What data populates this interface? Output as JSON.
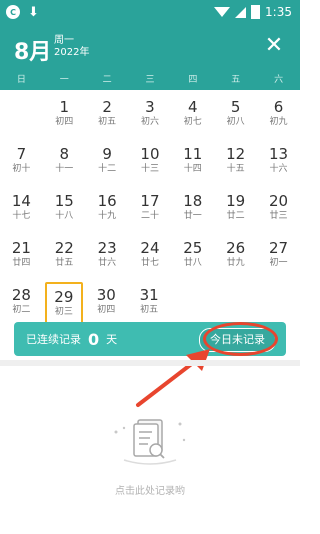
{
  "status_bar": {
    "time": "1:35"
  },
  "header": {
    "month": "8月",
    "weekday": "周一",
    "year": "2022年",
    "close_symbol": "✕"
  },
  "weekdays": [
    "日",
    "一",
    "二",
    "三",
    "四",
    "五",
    "六"
  ],
  "calendar": {
    "rows": [
      [
        null,
        {
          "day": "1",
          "lunar": "初四"
        },
        {
          "day": "2",
          "lunar": "初五"
        },
        {
          "day": "3",
          "lunar": "初六"
        },
        {
          "day": "4",
          "lunar": "初七"
        },
        {
          "day": "5",
          "lunar": "初八"
        },
        {
          "day": "6",
          "lunar": "初九"
        }
      ],
      [
        {
          "day": "7",
          "lunar": "初十"
        },
        {
          "day": "8",
          "lunar": "十一"
        },
        {
          "day": "9",
          "lunar": "十二"
        },
        {
          "day": "10",
          "lunar": "十三"
        },
        {
          "day": "11",
          "lunar": "十四"
        },
        {
          "day": "12",
          "lunar": "十五"
        },
        {
          "day": "13",
          "lunar": "十六"
        }
      ],
      [
        {
          "day": "14",
          "lunar": "十七"
        },
        {
          "day": "15",
          "lunar": "十八"
        },
        {
          "day": "16",
          "lunar": "十九"
        },
        {
          "day": "17",
          "lunar": "二十"
        },
        {
          "day": "18",
          "lunar": "廿一"
        },
        {
          "day": "19",
          "lunar": "廿二"
        },
        {
          "day": "20",
          "lunar": "廿三"
        }
      ],
      [
        {
          "day": "21",
          "lunar": "廿四"
        },
        {
          "day": "22",
          "lunar": "廿五"
        },
        {
          "day": "23",
          "lunar": "廿六"
        },
        {
          "day": "24",
          "lunar": "廿七"
        },
        {
          "day": "25",
          "lunar": "廿八"
        },
        {
          "day": "26",
          "lunar": "廿九"
        },
        {
          "day": "27",
          "lunar": "初一"
        }
      ],
      [
        {
          "day": "28",
          "lunar": "初二"
        },
        {
          "day": "29",
          "lunar": "初三",
          "today": true
        },
        {
          "day": "30",
          "lunar": "初四"
        },
        {
          "day": "31",
          "lunar": "初五"
        },
        null,
        null,
        null
      ]
    ]
  },
  "streak": {
    "prefix": "已连续记录",
    "count": "0",
    "suffix": "天",
    "button_label": "今日未记录"
  },
  "empty_state": {
    "text": "点击此处记录哟"
  },
  "colors": {
    "primary": "#2aa39a",
    "streak_bg": "#3fbcb1",
    "today_outline": "#f3b11d",
    "annotation": "#e8452e"
  }
}
